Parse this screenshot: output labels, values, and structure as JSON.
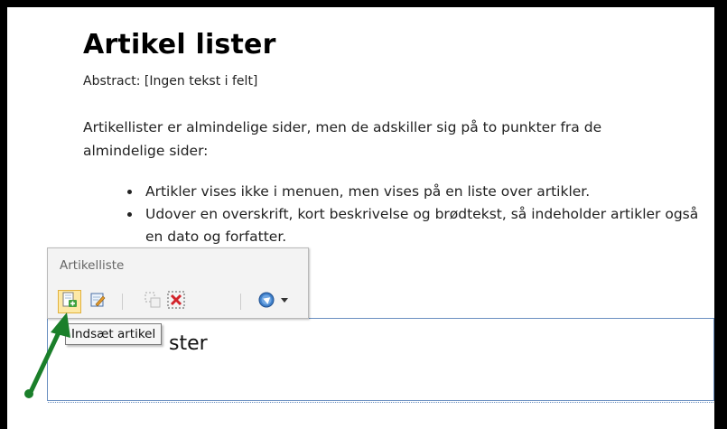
{
  "document": {
    "title": "Artikel lister",
    "abstract": "Abstract: [Ingen tekst i felt]",
    "paragraph": "Artikellister er almindelige sider, men de adskiller sig på to punkter fra de almindelige sider:",
    "bullets": [
      "Artikler vises ikke i menuen, men vises på en liste over artikler.",
      "Udover en overskrift, kort beskrivelse og brødtekst, så indeholder artikler også en dato og forfatter."
    ]
  },
  "toolbar": {
    "title": "Artikelliste",
    "buttons": [
      {
        "icon": "insert-article-icon",
        "active": true
      },
      {
        "icon": "edit-article-icon",
        "active": false
      },
      {
        "icon": "disabled-select-icon",
        "active": false
      },
      {
        "icon": "delete-icon",
        "active": false
      },
      {
        "icon": "navigate-dropdown-icon",
        "active": false
      }
    ]
  },
  "tooltip": {
    "text": "Indsæt artikel"
  },
  "list_box": {
    "heading": "ster"
  },
  "colors": {
    "arrow": "#1a7f2a",
    "active_button": "#fde9a6",
    "list_border": "#6a8fc0"
  }
}
